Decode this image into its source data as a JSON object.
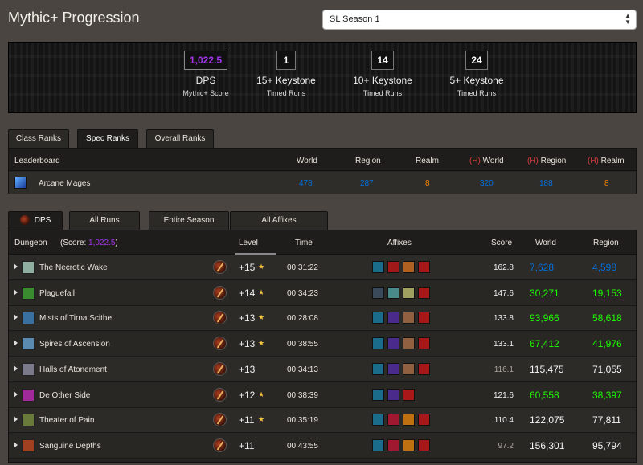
{
  "header": {
    "title": "Mythic+ Progression",
    "season": "SL Season 1"
  },
  "summary": {
    "stats": [
      {
        "value": "1,022.5",
        "label": "DPS",
        "sub": "Mythic+ Score"
      },
      {
        "value": "1",
        "label": "15+ Keystone",
        "sub": "Timed Runs"
      },
      {
        "value": "14",
        "label": "10+ Keystone",
        "sub": "Timed Runs"
      },
      {
        "value": "24",
        "label": "5+ Keystone",
        "sub": "Timed Runs"
      }
    ]
  },
  "rank_tabs": [
    "Class Ranks",
    "Spec Ranks",
    "Overall Ranks"
  ],
  "rank_tabs_active": "Spec Ranks",
  "ranks": {
    "headers": {
      "leaderboard": "Leaderboard",
      "world": "World",
      "region": "Region",
      "realm": "Realm",
      "h_tag": "(H)"
    },
    "row": {
      "name": "Arcane Mages",
      "world": "478",
      "region": "287",
      "realm": "8",
      "h_world": "320",
      "h_region": "188",
      "h_realm": "8"
    }
  },
  "run_tabs": [
    "DPS",
    "All Runs",
    "Entire Season",
    "All Affixes"
  ],
  "runs": {
    "headers": {
      "dungeon": "Dungeon",
      "score_prefix": "(Score:",
      "score_value": "1,022.5",
      "score_suffix": ")",
      "level": "Level",
      "time": "Time",
      "affixes": "Affixes",
      "score": "Score",
      "world": "World",
      "region": "Region"
    },
    "rows": [
      {
        "name": "The Necrotic Wake",
        "level": "+15",
        "timed": true,
        "time": "00:31:22",
        "score": "162.8",
        "world": "7,628",
        "region": "4,598",
        "rank_color": "blue",
        "icon": "#8fb0a0",
        "affixes": [
          "#1b6b8a",
          "#a01818",
          "#b06020",
          "#a81818"
        ]
      },
      {
        "name": "Plaguefall",
        "level": "+14",
        "timed": true,
        "time": "00:34:23",
        "score": "147.6",
        "world": "30,271",
        "region": "19,153",
        "rank_color": "green",
        "icon": "#3a8a30",
        "affixes": [
          "#3a4a5a",
          "#4a8a8a",
          "#a0a060",
          "#a81818"
        ]
      },
      {
        "name": "Mists of Tirna Scithe",
        "level": "+13",
        "timed": true,
        "time": "00:28:08",
        "score": "133.8",
        "world": "93,966",
        "region": "58,618",
        "rank_color": "green",
        "icon": "#3a70a0",
        "affixes": [
          "#1b6b8a",
          "#4a2a8a",
          "#906040",
          "#a81818"
        ]
      },
      {
        "name": "Spires of Ascension",
        "level": "+13",
        "timed": true,
        "time": "00:38:55",
        "score": "133.1",
        "world": "67,412",
        "region": "41,976",
        "rank_color": "green",
        "icon": "#5a8ab0",
        "affixes": [
          "#1b6b8a",
          "#4a2a8a",
          "#906040",
          "#a81818"
        ]
      },
      {
        "name": "Halls of Atonement",
        "level": "+13",
        "timed": false,
        "time": "00:34:13",
        "score": "116.1",
        "world": "115,475",
        "region": "71,055",
        "rank_color": "white",
        "icon": "#7a7a8a",
        "affixes": [
          "#1b6b8a",
          "#4a2a8a",
          "#906040",
          "#a81818"
        ]
      },
      {
        "name": "De Other Side",
        "level": "+12",
        "timed": true,
        "time": "00:38:39",
        "score": "121.6",
        "world": "60,558",
        "region": "38,397",
        "rank_color": "green",
        "icon": "#a02a9a",
        "affixes": [
          "#1b6b8a",
          "#4a2a8a",
          "#a81818"
        ]
      },
      {
        "name": "Theater of Pain",
        "level": "+11",
        "timed": true,
        "time": "00:35:19",
        "score": "110.4",
        "world": "122,075",
        "region": "77,811",
        "rank_color": "white",
        "icon": "#6a7a3a",
        "affixes": [
          "#1b6b8a",
          "#a01830",
          "#c07010",
          "#a81818"
        ]
      },
      {
        "name": "Sanguine Depths",
        "level": "+11",
        "timed": false,
        "time": "00:43:55",
        "score": "97.2",
        "world": "156,301",
        "region": "95,794",
        "rank_color": "white",
        "icon": "#a04020",
        "affixes": [
          "#1b6b8a",
          "#a01830",
          "#c07010",
          "#a81818"
        ]
      }
    ]
  }
}
